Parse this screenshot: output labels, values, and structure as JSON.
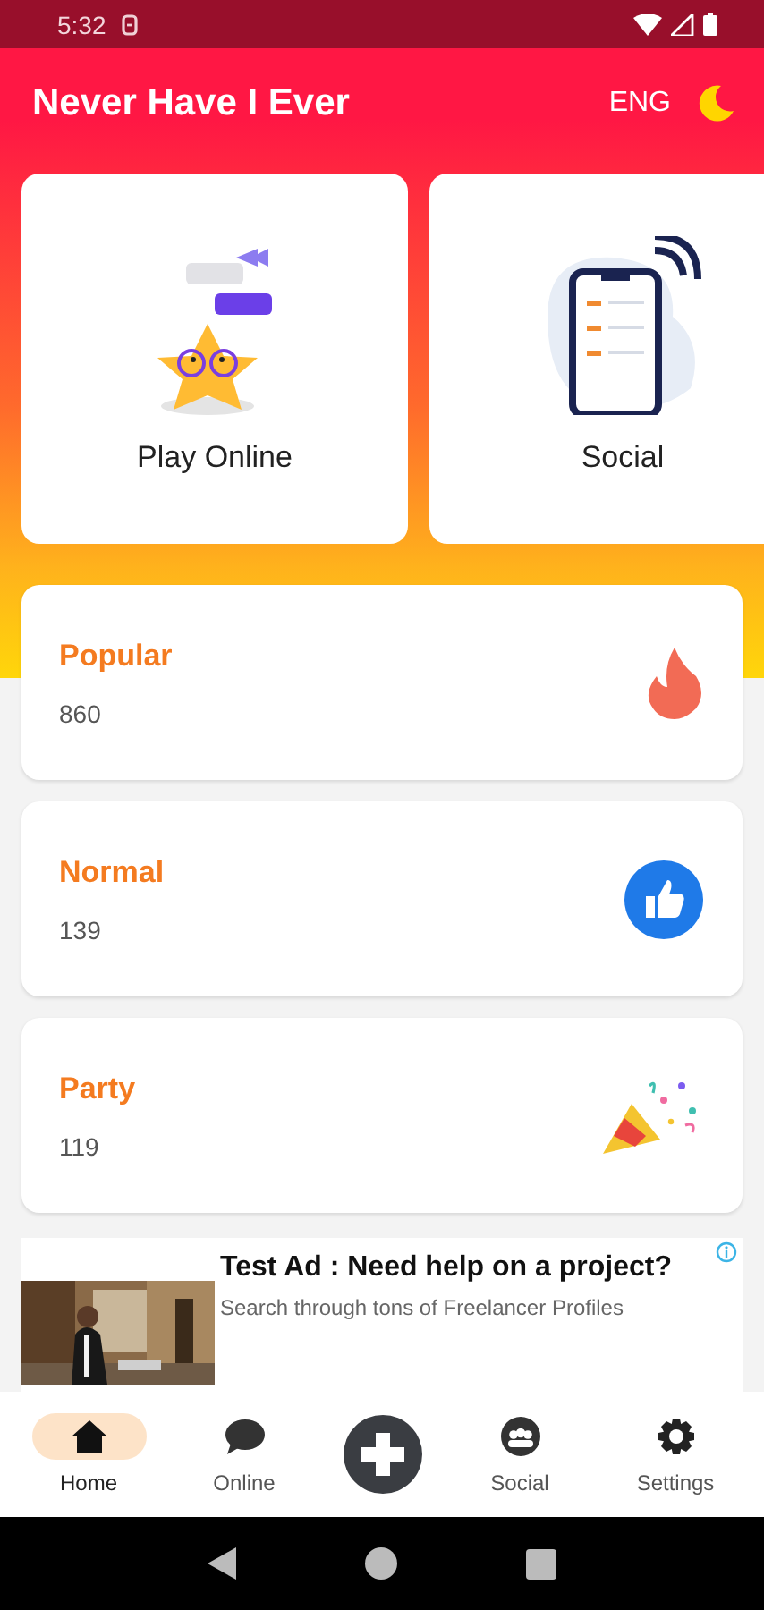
{
  "status_bar": {
    "time": "5:32"
  },
  "app_bar": {
    "title": "Never Have I Ever",
    "language": "ENG"
  },
  "feature_cards": [
    {
      "label": "Play Online"
    },
    {
      "label": "Social"
    }
  ],
  "categories": [
    {
      "title": "Popular",
      "count": "860"
    },
    {
      "title": "Normal",
      "count": "139"
    },
    {
      "title": "Party",
      "count": "119"
    }
  ],
  "ad": {
    "title": "Test Ad : Need help on a project?",
    "text": "Search through tons of Freelancer Profiles"
  },
  "bottom_nav": [
    {
      "kind": "tab",
      "label": "Home",
      "selected": true
    },
    {
      "kind": "tab",
      "label": "Online",
      "selected": false
    },
    {
      "kind": "action"
    },
    {
      "kind": "tab",
      "label": "Social",
      "selected": false
    },
    {
      "kind": "tab",
      "label": "Settings",
      "selected": false
    }
  ]
}
